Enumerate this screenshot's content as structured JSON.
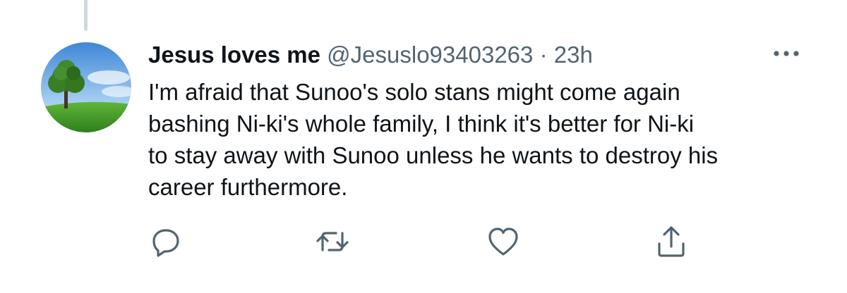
{
  "tweet": {
    "author": {
      "display_name": "Jesus loves me",
      "handle": "@Jesuslo93403263"
    },
    "separator": "·",
    "timestamp": "23h",
    "text": "I'm afraid that Sunoo's solo stans might come again\nbashing Ni-ki's whole family, I think it's better for Ni-ki\nto stay away with Sunoo unless he wants to destroy his\ncareer furthermore."
  },
  "icons": {
    "avatar": "tree-landscape-avatar",
    "more": "more-options-icon",
    "reply": "reply-icon",
    "retweet": "retweet-icon",
    "like": "heart-icon",
    "share": "share-icon"
  },
  "colors": {
    "text_primary": "#0f1419",
    "text_secondary": "#536471",
    "icon": "#536471",
    "thread_line": "#cfd9de"
  }
}
